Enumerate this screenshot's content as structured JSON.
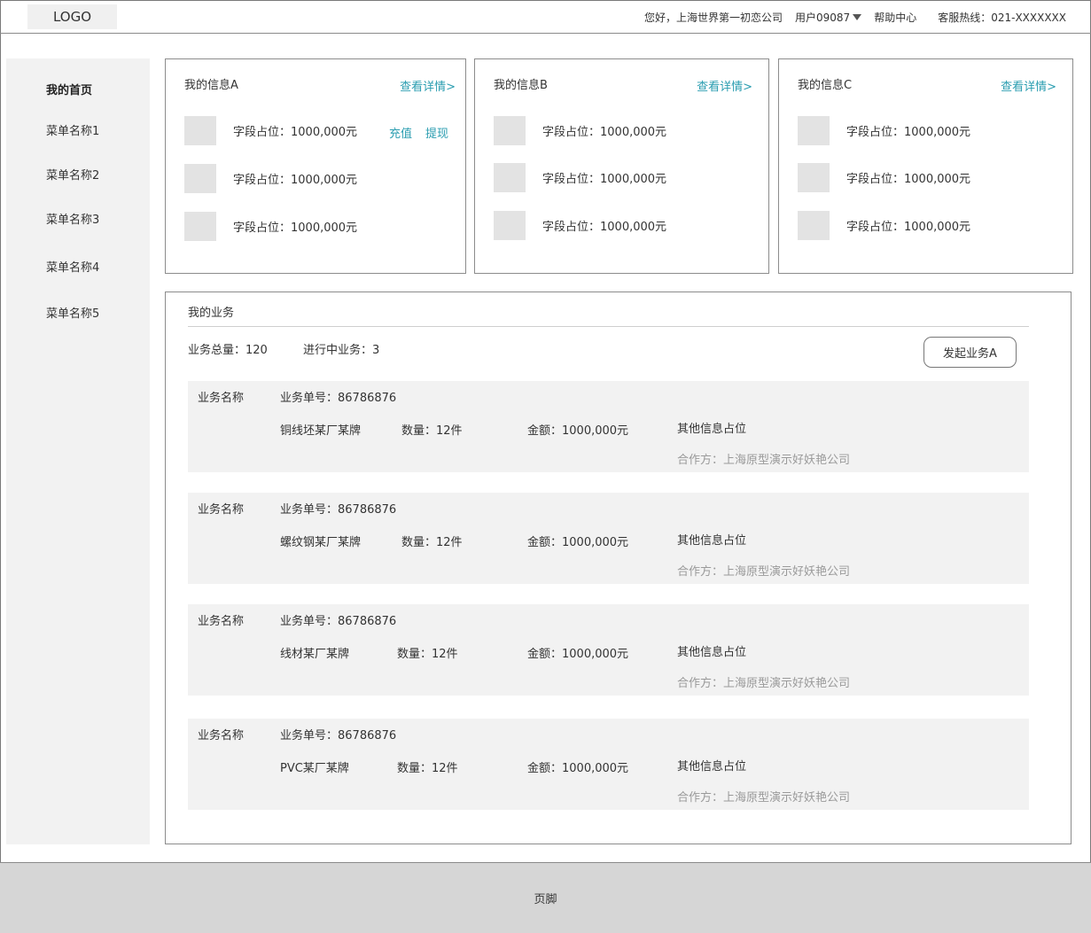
{
  "header": {
    "logo": "LOGO",
    "greeting": "您好，上海世界第一初恋公司",
    "user": "用户09087",
    "help": "帮助中心",
    "hotline": "客服热线：021-XXXXXXX"
  },
  "sidebar": {
    "items": [
      {
        "label": "我的首页",
        "active": true
      },
      {
        "label": "菜单名称1"
      },
      {
        "label": "菜单名称2"
      },
      {
        "label": "菜单名称3"
      },
      {
        "label": "菜单名称4"
      },
      {
        "label": "菜单名称5"
      }
    ]
  },
  "cards": [
    {
      "title": "我的信息A",
      "link": "查看详情>",
      "fields": [
        "字段占位：1000,000元",
        "字段占位：1000,000元",
        "字段占位：1000,000元"
      ],
      "actions": [
        "充值",
        "提现"
      ]
    },
    {
      "title": "我的信息B",
      "link": "查看详情>",
      "fields": [
        "字段占位：1000,000元",
        "字段占位：1000,000元",
        "字段占位：1000,000元"
      ]
    },
    {
      "title": "我的信息C",
      "link": "查看详情>",
      "fields": [
        "字段占位：1000,000元",
        "字段占位：1000,000元",
        "字段占位：1000,000元"
      ]
    }
  ],
  "business": {
    "title": "我的业务",
    "total": "业务总量：120",
    "in_progress": "进行中业务：3",
    "start_button": "发起业务A",
    "rows": [
      {
        "name": "业务名称",
        "order": "业务单号：86786876",
        "product": "铜线坯某厂某牌",
        "qty": "数量：12件",
        "amount": "金额：1000,000元",
        "other": "其他信息占位",
        "partner": "合作方：上海原型演示好妖艳公司"
      },
      {
        "name": "业务名称",
        "order": "业务单号：86786876",
        "product": "螺纹钢某厂某牌",
        "qty": "数量：12件",
        "amount": "金额：1000,000元",
        "other": "其他信息占位",
        "partner": "合作方：上海原型演示好妖艳公司"
      },
      {
        "name": "业务名称",
        "order": "业务单号：86786876",
        "product": "线材某厂某牌",
        "qty": "数量：12件",
        "amount": "金额：1000,000元",
        "other": "其他信息占位",
        "partner": "合作方：上海原型演示好妖艳公司"
      },
      {
        "name": "业务名称",
        "order": "业务单号：86786876",
        "product": "PVC某厂某牌",
        "qty": "数量：12件",
        "amount": "金额：1000,000元",
        "other": "其他信息占位",
        "partner": "合作方：上海原型演示好妖艳公司"
      }
    ]
  },
  "footer": {
    "label": "页脚"
  },
  "colors": {
    "link": "#2a9db0",
    "sidebar_bg": "#f2f2f2",
    "row_bg": "#f2f2f2",
    "footer_bg": "#d6d6d6"
  }
}
